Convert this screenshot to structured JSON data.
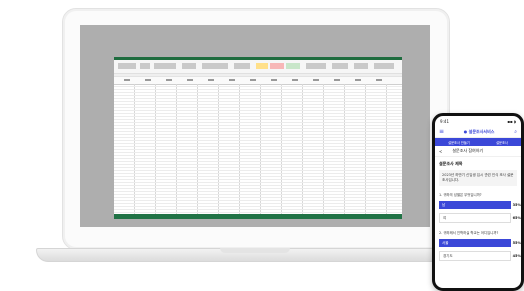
{
  "phone": {
    "status_time": "9:41",
    "status_icons": "▪▪ ◗",
    "brand": "● 설문조사서비스",
    "tabs": [
      "설문조사 만들기",
      "설문조사"
    ],
    "subheader": "설문조사 참여하기",
    "back_label": "<",
    "survey_title": "설문조사 제목",
    "survey_description": "2023년 하반기 신입생 입시 관련 인식 조사 설문조사입니다.",
    "questions": [
      {
        "label": "1. 귀하의 성별은 무엇입니까?",
        "options": [
          {
            "text": "남",
            "percent": "35%"
          },
          {
            "text": "여",
            "percent": "65%"
          }
        ]
      },
      {
        "label": "2. 귀하께서 진학하실 학교는 어디입니까?",
        "options": [
          {
            "text": "서울",
            "percent": "55%"
          },
          {
            "text": "경기도",
            "percent": "45%"
          }
        ]
      }
    ],
    "brand_color": "#3b48d8"
  }
}
